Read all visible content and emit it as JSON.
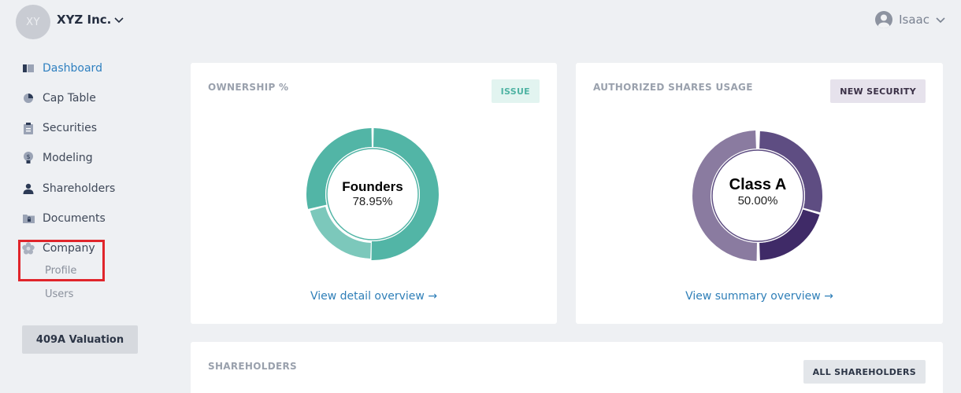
{
  "header": {
    "company_initials": "XY",
    "company_name": "XYZ Inc.",
    "user_name": "Isaac"
  },
  "sidebar": {
    "items": [
      {
        "label": "Dashboard",
        "icon": "dashboard-icon"
      },
      {
        "label": "Cap Table",
        "icon": "pie-chart-icon"
      },
      {
        "label": "Securities",
        "icon": "clipboard-icon"
      },
      {
        "label": "Modeling",
        "icon": "lightbulb-dollar-icon"
      },
      {
        "label": "Shareholders",
        "icon": "person-icon"
      },
      {
        "label": "Documents",
        "icon": "folder-lock-icon"
      },
      {
        "label": "Company",
        "icon": "flower-icon"
      }
    ],
    "company_sub_items": [
      "Profile",
      "Users"
    ],
    "valuation_button": "409A Valuation"
  },
  "ownership_card": {
    "title": "OWNERSHIP %",
    "action_label": "ISSUE",
    "center_name": "Founders",
    "center_value": "78.95%",
    "link_label": "View detail overview",
    "link_arrow": "→",
    "colors": {
      "primary": "#52b5a6",
      "secondary": "#7cc8bb"
    }
  },
  "authorized_card": {
    "title": "AUTHORIZED SHARES USAGE",
    "action_label": "NEW SECURITY",
    "center_name": "Class A",
    "center_value": "50.00%",
    "link_label": "View summary overview",
    "link_arrow": "→",
    "colors": {
      "primary": "#8a7ba0",
      "dark1": "#5e4d82",
      "dark2": "#3f2a67"
    }
  },
  "shareholders_card": {
    "title": "SHAREHOLDERS",
    "action_label": "ALL SHAREHOLDERS"
  },
  "accent_color": "#2f80c0"
}
